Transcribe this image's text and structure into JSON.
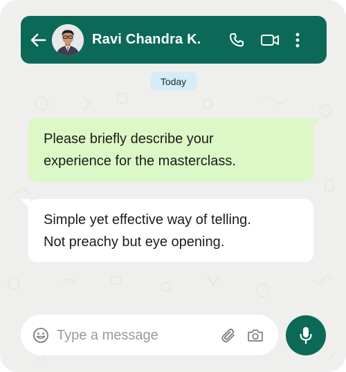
{
  "header": {
    "contact_name": "Ravi Chandra K.",
    "icons": [
      "back-arrow-icon",
      "avatar",
      "phone-icon",
      "video-camera-icon",
      "more-vertical-icon"
    ]
  },
  "chat": {
    "date_label": "Today",
    "messages": [
      {
        "direction": "outgoing",
        "lines": [
          "Please briefly describe your",
          "experience for the masterclass."
        ]
      },
      {
        "direction": "incoming",
        "lines": [
          "Simple yet effective way of telling.",
          "Not preachy but eye opening."
        ]
      }
    ]
  },
  "composer": {
    "placeholder": "Type a message",
    "value": "",
    "icons": [
      "emoji-icon",
      "paperclip-icon",
      "camera-icon",
      "microphone-icon"
    ]
  },
  "colors": {
    "brand": "#0c6957",
    "outgoing_bubble": "#dcf8c6",
    "incoming_bubble": "#ffffff",
    "date_chip": "#d7ecf9",
    "background": "#efefed"
  }
}
